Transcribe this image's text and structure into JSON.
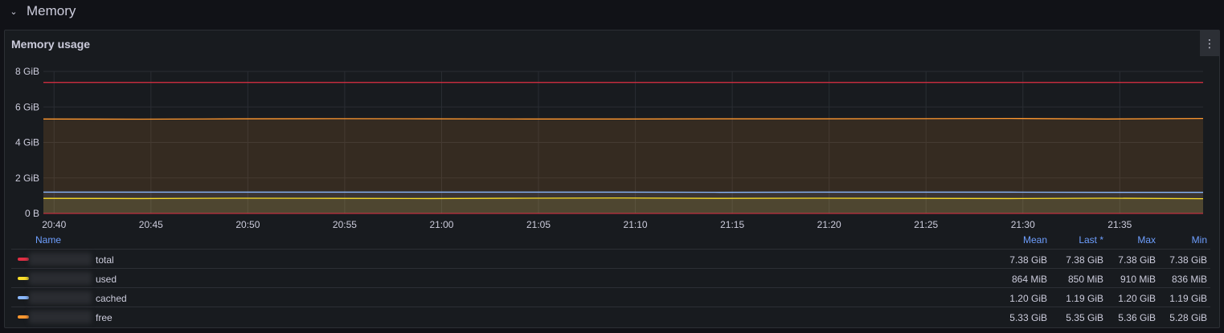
{
  "row": {
    "title": "Memory"
  },
  "panel": {
    "title": "Memory usage"
  },
  "chart_data": {
    "type": "area",
    "title": "Memory usage",
    "y_unit": "GiB",
    "ylim": [
      0,
      8
    ],
    "y_ticks": [
      "0 B",
      "2 GiB",
      "4 GiB",
      "6 GiB",
      "8 GiB"
    ],
    "y_tick_values": [
      0,
      2,
      4,
      6,
      8
    ],
    "x_ticks": [
      "20:40",
      "20:45",
      "20:50",
      "20:55",
      "21:00",
      "21:05",
      "21:10",
      "21:15",
      "21:20",
      "21:25",
      "21:30",
      "21:35"
    ],
    "x_start": "20:40",
    "x_end": "21:39",
    "grid": true,
    "series": [
      {
        "name": "total",
        "color": "#e02f44",
        "values": [
          7.38,
          7.38,
          7.38,
          7.38,
          7.38,
          7.38,
          7.38,
          7.38,
          7.38,
          7.38,
          7.38,
          7.38,
          7.38
        ]
      },
      {
        "name": "used",
        "color": "#fade2a",
        "values": [
          0.85,
          0.84,
          0.86,
          0.85,
          0.84,
          0.86,
          0.87,
          0.85,
          0.86,
          0.85,
          0.84,
          0.86,
          0.83
        ]
      },
      {
        "name": "cached",
        "color": "#8ab8ff",
        "values": [
          1.2,
          1.2,
          1.2,
          1.2,
          1.2,
          1.2,
          1.2,
          1.19,
          1.2,
          1.2,
          1.2,
          1.19,
          1.19
        ]
      },
      {
        "name": "free",
        "color": "#ff9830",
        "values": [
          5.32,
          5.31,
          5.33,
          5.34,
          5.33,
          5.32,
          5.32,
          5.33,
          5.33,
          5.34,
          5.35,
          5.32,
          5.35
        ]
      }
    ]
  },
  "legend": {
    "headers": {
      "name": "Name",
      "mean": "Mean",
      "last": "Last *",
      "max": "Max",
      "min": "Min"
    },
    "rows": [
      {
        "name": "total",
        "color": "#e02f44",
        "mean": "7.38 GiB",
        "last": "7.38 GiB",
        "max": "7.38 GiB",
        "min": "7.38 GiB"
      },
      {
        "name": "used",
        "color": "#fade2a",
        "mean": "864 MiB",
        "last": "850 MiB",
        "max": "910 MiB",
        "min": "836 MiB"
      },
      {
        "name": "cached",
        "color": "#8ab8ff",
        "mean": "1.20 GiB",
        "last": "1.19 GiB",
        "max": "1.20 GiB",
        "min": "1.19 GiB"
      },
      {
        "name": "free",
        "color": "#ff9830",
        "mean": "5.33 GiB",
        "last": "5.35 GiB",
        "max": "5.36 GiB",
        "min": "5.28 GiB"
      }
    ]
  },
  "icons": {
    "row_toggle": "chevron-down-icon",
    "panel_menu": "kebab-menu-icon"
  }
}
